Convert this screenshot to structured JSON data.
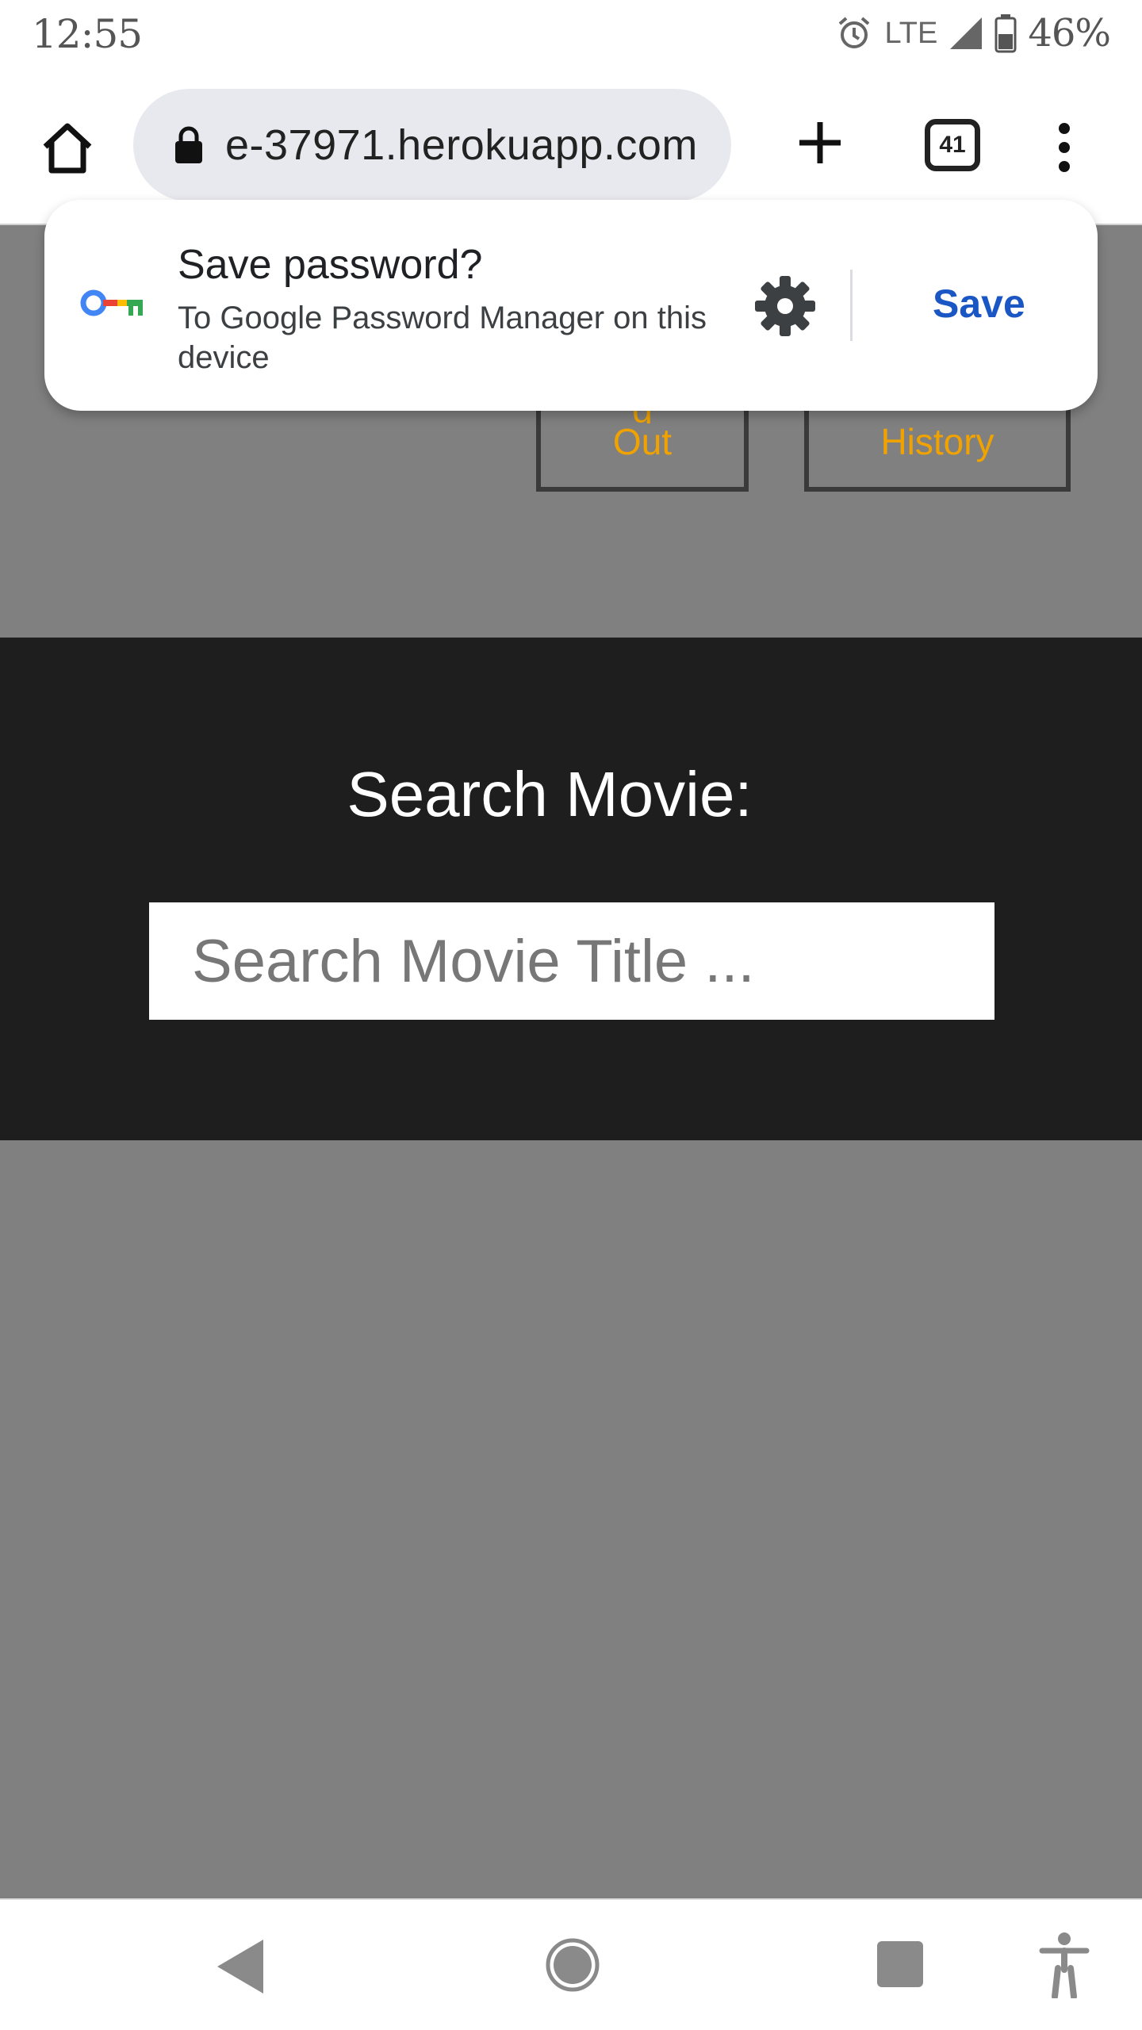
{
  "status_bar": {
    "time": "12:55",
    "network": "LTE",
    "battery": "46%",
    "icons": [
      "alarm-icon",
      "signal-icon",
      "battery-icon"
    ]
  },
  "browser": {
    "url": "e-37971.herokuapp.com",
    "tab_count": "41",
    "icons": [
      "home-icon",
      "lock-icon",
      "plus-icon",
      "tabs-icon",
      "more-vert-icon"
    ]
  },
  "page": {
    "nav_buttons": {
      "logout": "Out",
      "history": "History"
    },
    "search": {
      "title": "Search Movie:",
      "placeholder": "Search Movie Title ..."
    },
    "colors": {
      "accent": "#f0a300",
      "band": "#1e1e1e",
      "overlay": "#808080"
    }
  },
  "save_password_prompt": {
    "title": "Save password?",
    "subtitle": "To Google Password Manager on this device",
    "save_label": "Save",
    "icons": [
      "key-icon",
      "settings-gear-icon"
    ],
    "accent": "#1a56c4"
  },
  "nav_bar": {
    "icons": [
      "back-icon",
      "home-circle-icon",
      "recents-icon",
      "accessibility-icon"
    ]
  }
}
